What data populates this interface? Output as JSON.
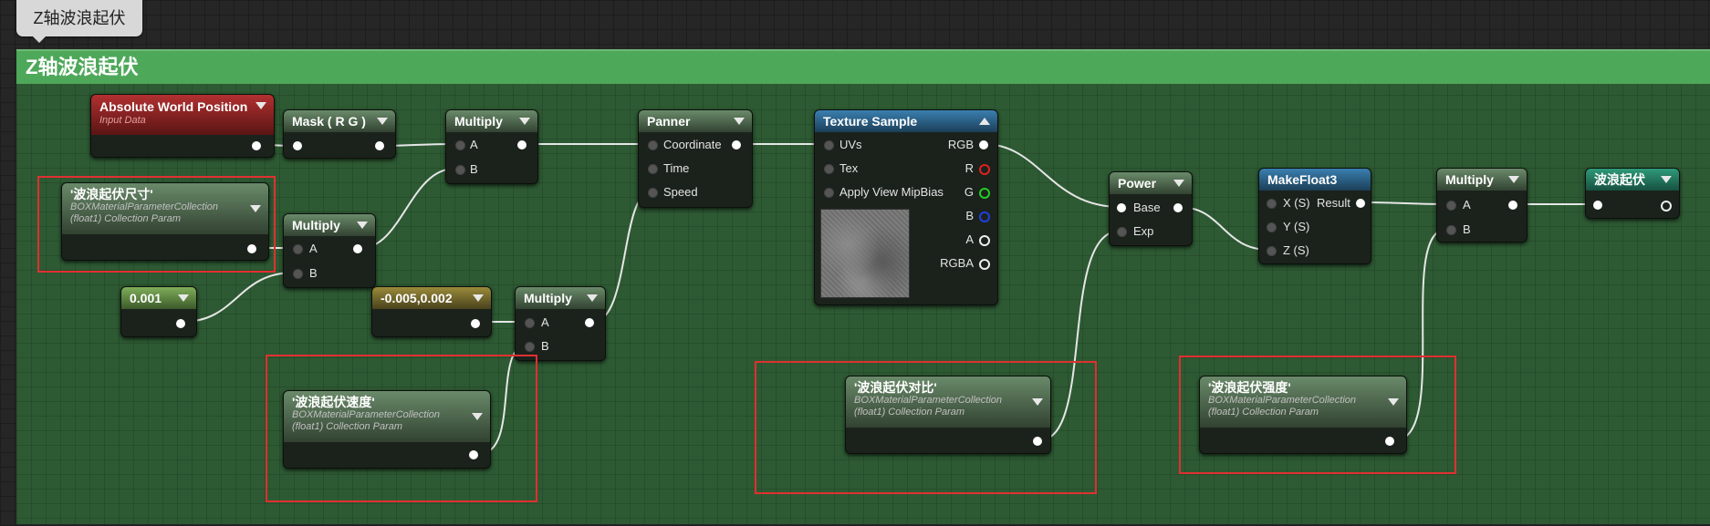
{
  "tab_label": "Z轴波浪起伏",
  "comment_title": "Z轴波浪起伏",
  "nodes": {
    "abs_world_pos": {
      "title": "Absolute World Position",
      "subtitle": "Input Data"
    },
    "mask_rg": {
      "title": "Mask ( R G )"
    },
    "multiply1": {
      "title": "Multiply",
      "pin_a": "A",
      "pin_b": "B"
    },
    "multiply2": {
      "title": "Multiply",
      "pin_a": "A",
      "pin_b": "B"
    },
    "multiply3": {
      "title": "Multiply",
      "pin_a": "A",
      "pin_b": "B"
    },
    "multiply4": {
      "title": "Multiply",
      "pin_a": "A",
      "pin_b": "B"
    },
    "panner": {
      "title": "Panner",
      "pins": [
        "Coordinate",
        "Time",
        "Speed"
      ]
    },
    "texture_sample": {
      "title": "Texture Sample",
      "inputs": [
        "UVs",
        "Tex",
        "Apply View MipBias"
      ],
      "outputs": [
        "RGB",
        "R",
        "G",
        "B",
        "A",
        "RGBA"
      ]
    },
    "power": {
      "title": "Power",
      "pin_base": "Base",
      "pin_exp": "Exp"
    },
    "makefloat3": {
      "title": "MakeFloat3",
      "pins": [
        "X (S)",
        "Y (S)",
        "Z (S)"
      ],
      "result": "Result"
    },
    "output": {
      "title": "波浪起伏"
    },
    "const_001": {
      "title": "0.001"
    },
    "const_speed": {
      "title": "-0.005,0.002"
    },
    "param_size": {
      "title": "'波浪起伏尺寸'",
      "sub1": "BOXMaterialParameterCollection",
      "sub2": "(float1) Collection Param"
    },
    "param_speed": {
      "title": "'波浪起伏速度'",
      "sub1": "BOXMaterialParameterCollection",
      "sub2": "(float1) Collection Param"
    },
    "param_contrast": {
      "title": "'波浪起伏对比'",
      "sub1": "BOXMaterialParameterCollection",
      "sub2": "(float1) Collection Param"
    },
    "param_strength": {
      "title": "'波浪起伏强度'",
      "sub1": "BOXMaterialParameterCollection",
      "sub2": "(float1) Collection Param"
    }
  },
  "colors": {
    "comment_bg": "#2d5a33",
    "comment_header": "#4ea85a",
    "highlight_box": "#e03030"
  }
}
